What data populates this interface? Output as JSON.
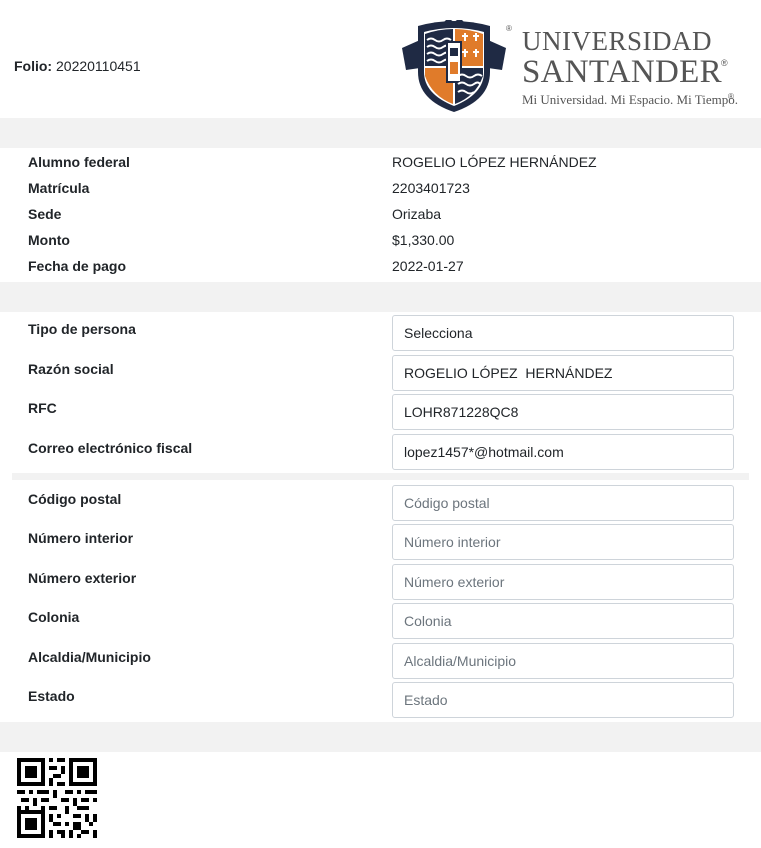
{
  "folio": {
    "label": "Folio:",
    "value": "20220110451"
  },
  "logo": {
    "line1": "UNIVERSIDAD",
    "line2": "SANTANDER",
    "tagline": "Mi Universidad. Mi Espacio. Mi Tiempo.",
    "registered": "®",
    "colors": {
      "navy": "#1f2a44",
      "orange": "#e07b2a",
      "text": "#555555"
    }
  },
  "info": [
    {
      "label": "Alumno federal",
      "value": "ROGELIO LÓPEZ HERNÁNDEZ"
    },
    {
      "label": "Matrícula",
      "value": "2203401723"
    },
    {
      "label": "Sede",
      "value": "Orizaba"
    },
    {
      "label": "Monto",
      "value": "$1,330.00"
    },
    {
      "label": "Fecha de pago",
      "value": "2022-01-27"
    }
  ],
  "fiscal": [
    {
      "label": "Tipo de persona",
      "value": "Selecciona",
      "placeholder": ""
    },
    {
      "label": "Razón social",
      "value": "ROGELIO LÓPEZ  HERNÁNDEZ",
      "placeholder": ""
    },
    {
      "label": "RFC",
      "value": "LOHR871228QC8",
      "placeholder": ""
    },
    {
      "label": "Correo electrónico fiscal",
      "value": "lopez1457*@hotmail.com",
      "placeholder": ""
    }
  ],
  "address": [
    {
      "label": "Código postal",
      "value": "",
      "placeholder": "Código postal"
    },
    {
      "label": "Número interior",
      "value": "",
      "placeholder": "Número interior"
    },
    {
      "label": "Número exterior",
      "value": "",
      "placeholder": "Número exterior"
    },
    {
      "label": "Colonia",
      "value": "",
      "placeholder": "Colonia"
    },
    {
      "label": "Alcaldia/Municipio",
      "value": "",
      "placeholder": "Alcaldia/Municipio"
    },
    {
      "label": "Estado",
      "value": "",
      "placeholder": "Estado"
    }
  ],
  "qr": {
    "icon": "qr-code-icon"
  }
}
